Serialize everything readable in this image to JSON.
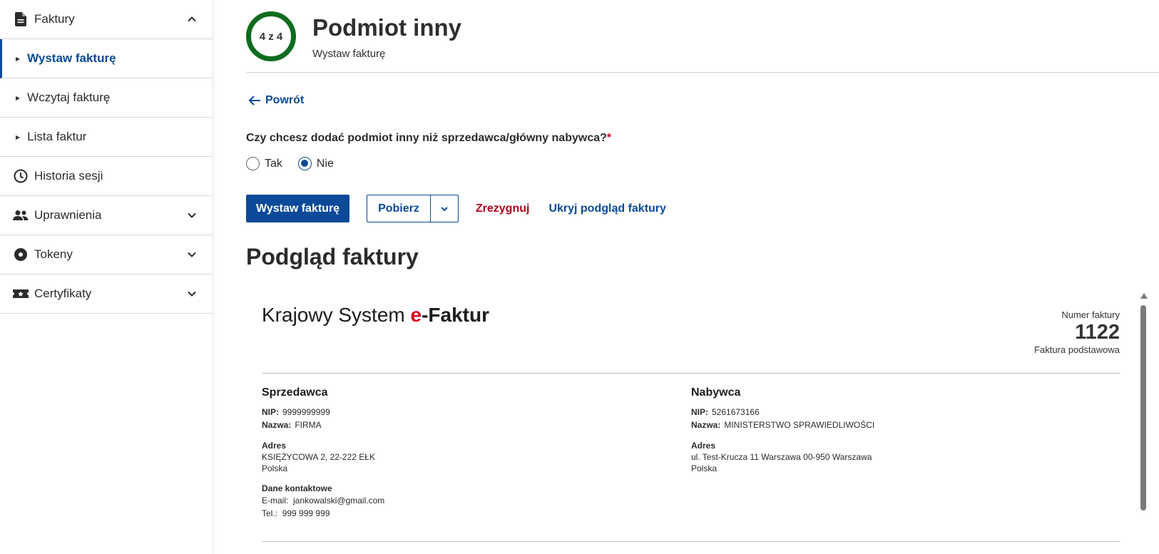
{
  "sidebar": {
    "items": [
      {
        "label": "Faktury"
      },
      {
        "label": "Wystaw fakturę"
      },
      {
        "label": "Wczytaj fakturę"
      },
      {
        "label": "Lista faktur"
      },
      {
        "label": "Historia sesji"
      },
      {
        "label": "Uprawnienia"
      },
      {
        "label": "Tokeny"
      },
      {
        "label": "Certyfikaty"
      }
    ]
  },
  "header": {
    "step": "4 z 4",
    "title": "Podmiot inny",
    "subtitle": "Wystaw fakturę"
  },
  "back_label": "Powrót",
  "question": {
    "text": "Czy chcesz dodać podmiot inny niż sprzedawca/główny nabywca?",
    "required_mark": "*",
    "options": [
      {
        "label": "Tak"
      },
      {
        "label": "Nie"
      }
    ],
    "selected": "Nie"
  },
  "actions": {
    "submit": "Wystaw fakturę",
    "download": "Pobierz",
    "cancel": "Zrezygnuj",
    "hide_preview": "Ukryj podgląd faktury"
  },
  "preview": {
    "heading": "Podgląd faktury",
    "brand_prefix": "Krajowy System ",
    "brand_e": "e",
    "brand_suffix": "-Faktur",
    "number_label": "Numer faktury",
    "number": "1122",
    "type": "Faktura podstawowa",
    "seller": {
      "title": "Sprzedawca",
      "nip_label": "NIP:",
      "nip": "9999999999",
      "name_label": "Nazwa:",
      "name": "FIRMA",
      "address_title": "Adres",
      "address_line1": "KSIĘŻYCOWA 2, 22-222 EŁK",
      "address_line2": "Polska",
      "contact_title": "Dane kontaktowe",
      "email_label": "E-mail:",
      "email": "jankowalski@gmail.com",
      "phone_label": "Tel.:",
      "phone": "999 999 999"
    },
    "buyer": {
      "title": "Nabywca",
      "nip_label": "NIP:",
      "nip": "5261673166",
      "name_label": "Nazwa:",
      "name": "MINISTERSTWO SPRAWIEDLIWOŚCI",
      "address_title": "Adres",
      "address_line1": "ul. Test-Krucza 11 Warszawa 00-950 Warszawa",
      "address_line2": "Polska"
    }
  },
  "colors": {
    "primary": "#0a4a99",
    "danger": "#b3001b",
    "step_ring": "#0f6b1e",
    "brand_red": "#d6001c"
  }
}
